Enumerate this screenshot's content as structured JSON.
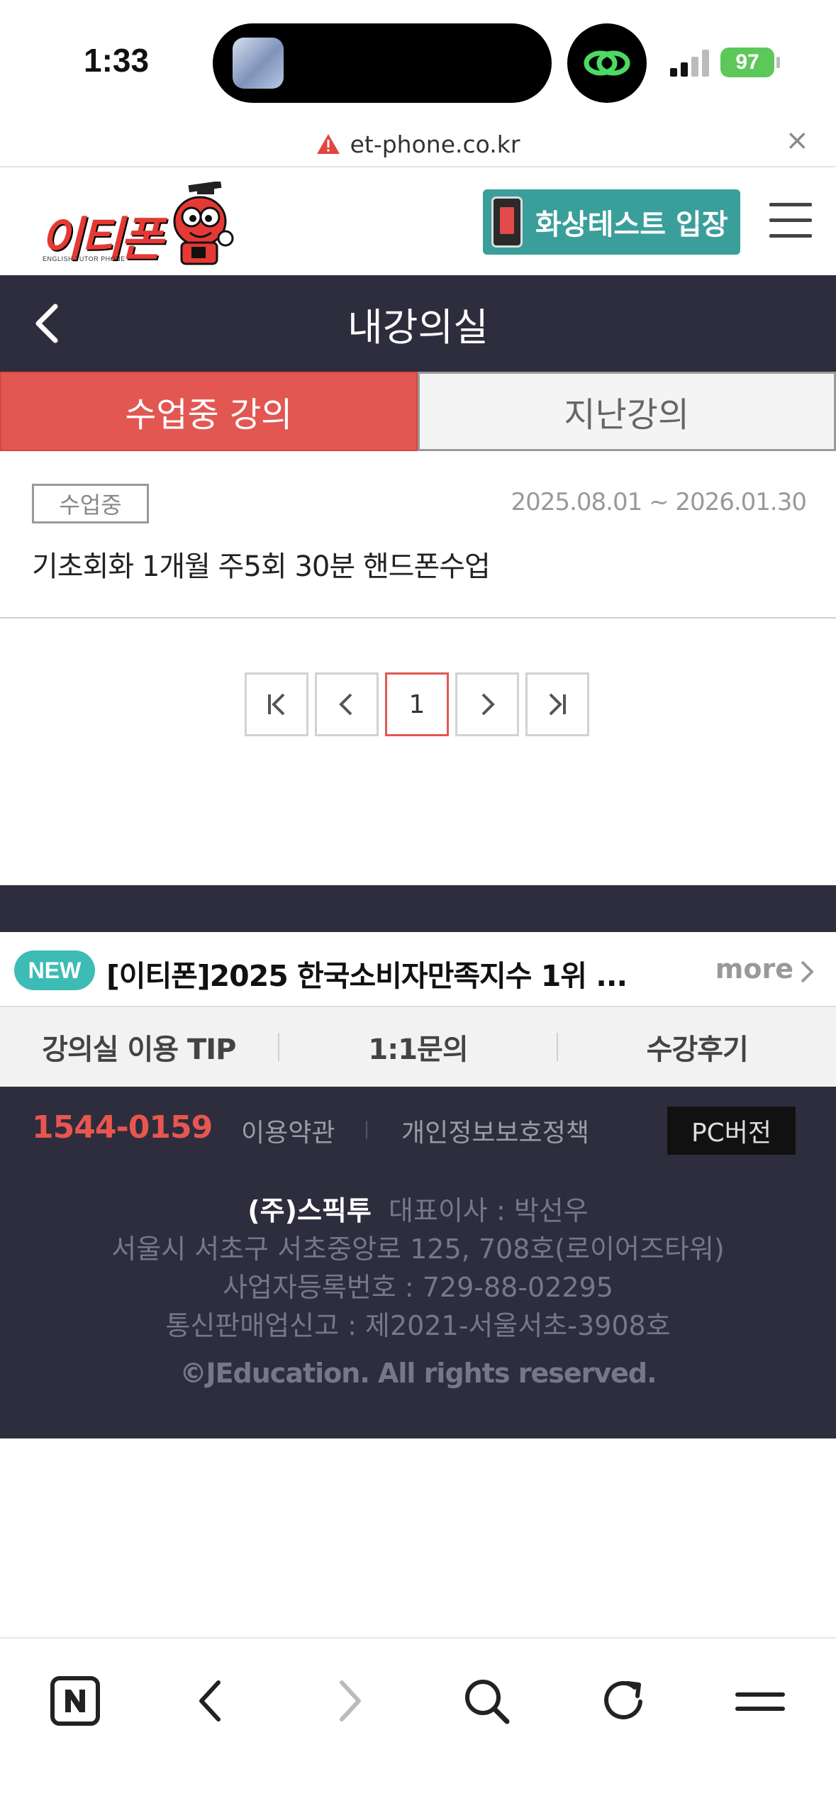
{
  "status_bar": {
    "time": "1:33",
    "battery": "97"
  },
  "browser": {
    "url": "et-phone.co.kr"
  },
  "header": {
    "logo_text": "이티폰",
    "logo_sub": "ENGLISH TUTOR PHONE",
    "video_test_label": "화상테스트 입장"
  },
  "page": {
    "title": "내강의실"
  },
  "tabs": [
    {
      "label": "수업중 강의",
      "active": true
    },
    {
      "label": "지난강의",
      "active": false
    }
  ],
  "lecture": {
    "status": "수업중",
    "period": "2025.08.01 ~ 2026.01.30",
    "course_name": "기초회화 1개월 주5회 30분 핸드폰수업"
  },
  "pagination": {
    "current_page": "1"
  },
  "notice": {
    "badge": "NEW",
    "text": "[이티폰]2025 한국소비자만족지수 1위 ...",
    "more_label": "more"
  },
  "footer_links": [
    "강의실 이용 TIP",
    "1:1문의",
    "수강후기"
  ],
  "footer": {
    "phone": "1544-0159",
    "terms": "이용약관",
    "privacy": "개인정보보호정책",
    "pc_version": "PC버전",
    "company_name": "(주)스픽투",
    "ceo": "대표이사 : 박선우",
    "address": "서울시 서초구 서초중앙로 125, 708호(로이어즈타워)",
    "business_number": "사업자등록번호 : 729-88-02295",
    "mail_order": "통신판매업신고 : 제2021-서울서초-3908호",
    "copyright": "©JEducation. All rights reserved."
  },
  "colors": {
    "dark_bar": "#2d2d3d",
    "accent_red": "#e25752",
    "teal_button": "#3a9e9b",
    "new_badge": "#3dbcb5"
  },
  "icons": {
    "toolbar": [
      "naver-n-icon",
      "back-chevron-icon",
      "forward-chevron-icon",
      "search-icon",
      "reload-icon",
      "menu-icon"
    ]
  }
}
